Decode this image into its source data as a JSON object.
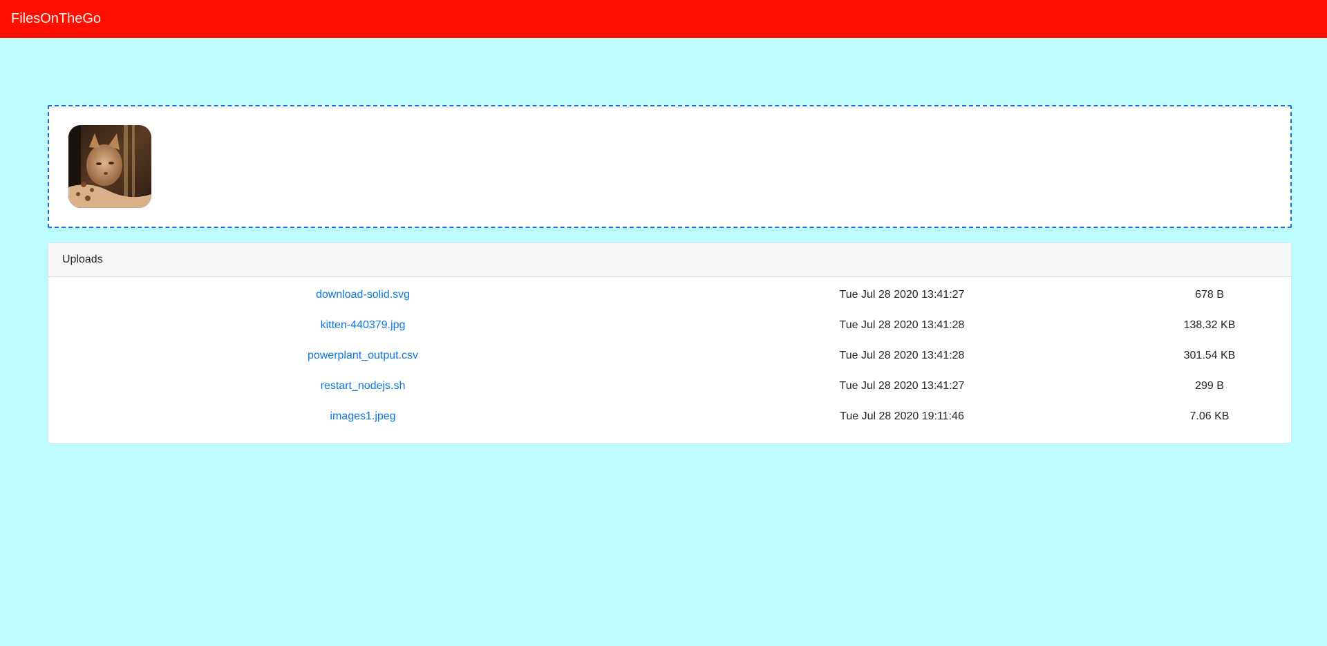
{
  "app": {
    "brand": "FilesOnTheGo"
  },
  "dropzone": {
    "thumbnail_icon": "cat-photo-thumbnail"
  },
  "uploads": {
    "title": "Uploads",
    "files": [
      {
        "name": "download-solid.svg",
        "date": "Tue Jul 28 2020 13:41:27",
        "size": "678 B"
      },
      {
        "name": "kitten-440379.jpg",
        "date": "Tue Jul 28 2020 13:41:28",
        "size": "138.32 KB"
      },
      {
        "name": "powerplant_output.csv",
        "date": "Tue Jul 28 2020 13:41:28",
        "size": "301.54 KB"
      },
      {
        "name": "restart_nodejs.sh",
        "date": "Tue Jul 28 2020 13:41:27",
        "size": "299 B"
      },
      {
        "name": "images1.jpeg",
        "date": "Tue Jul 28 2020 19:11:46",
        "size": "7.06 KB"
      }
    ]
  },
  "colors": {
    "navbar": "#ff0f00",
    "page_background": "#bdfbfc",
    "link": "#0a76e8",
    "dropzone_border": "#0d6fe0"
  }
}
